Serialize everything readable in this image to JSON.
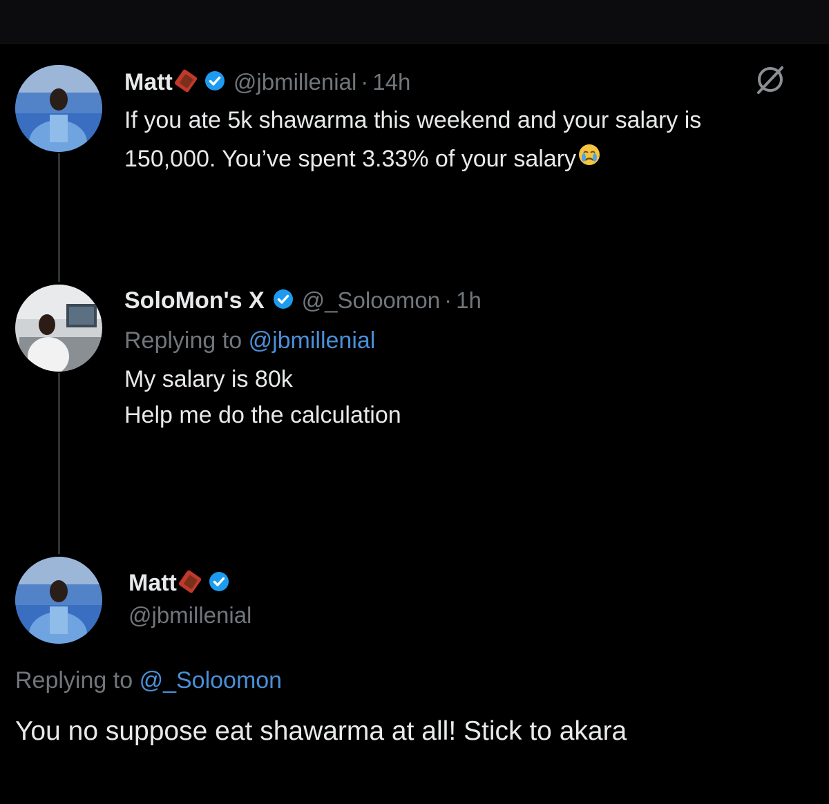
{
  "tweets": [
    {
      "display_name": "Matt",
      "handle": "@jbmillenial",
      "separator": "·",
      "time": "14h",
      "text_line1": "If you ate 5k shawarma this weekend and your salary is",
      "text_line2": "150,000. You’ve spent 3.33% of your salary"
    },
    {
      "display_name": "SoloMon's X",
      "handle": "@_Soloomon",
      "separator": "·",
      "time": "1h",
      "replying_prefix": "Replying to",
      "replying_handle": "@jbmillenial",
      "text_line1": "My salary is 80k",
      "text_line2": "Help me do the calculation"
    },
    {
      "display_name": "Matt",
      "handle": "@jbmillenial",
      "replying_prefix": "Replying to",
      "replying_handle": "@_Soloomon",
      "text": "You no suppose eat shawarma at all! Stick to akara"
    }
  ],
  "icons": {
    "verified_badge": "verified-icon",
    "name_emoji": "chocolate-emoji-icon",
    "text_emoji": "crying-face-emoji-icon",
    "grok": "grok-icon"
  },
  "colors": {
    "background": "#000000",
    "text_primary": "#e7e9ea",
    "text_secondary": "#71767b",
    "link": "#4a8fd8",
    "verified": "#1d9bf0"
  }
}
